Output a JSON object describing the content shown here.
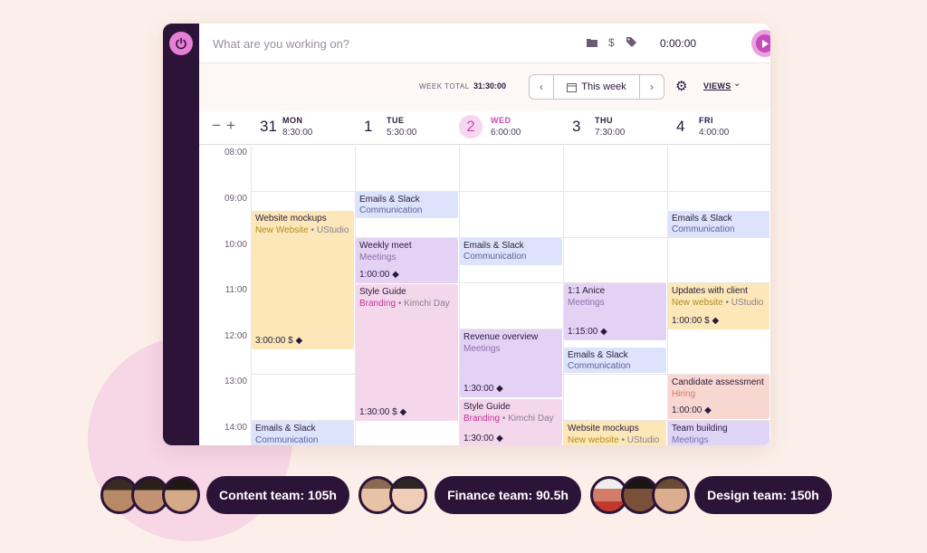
{
  "topbar": {
    "placeholder": "What are you working on?",
    "timer": "0:00:00",
    "icons": [
      "folder-icon",
      "dollar-icon",
      "tag-icon",
      "play-icon",
      "clock-icon",
      "list-icon"
    ]
  },
  "subbar": {
    "week_total_label": "WEEK TOTAL",
    "week_total_value": "31:30:00",
    "week_label": "This week",
    "views_label": "VIEWS"
  },
  "days": [
    {
      "num": "31",
      "name": "MON",
      "total": "8:30:00",
      "today": false
    },
    {
      "num": "1",
      "name": "TUE",
      "total": "5:30:00",
      "today": false
    },
    {
      "num": "2",
      "name": "WED",
      "total": "6:00:00",
      "today": true
    },
    {
      "num": "3",
      "name": "THU",
      "total": "7:30:00",
      "today": false
    },
    {
      "num": "4",
      "name": "FRI",
      "total": "4:00:00",
      "today": false
    }
  ],
  "hours": [
    "08:00",
    "09:00",
    "10:00",
    "11:00",
    "12:00",
    "13:00",
    "14:00"
  ],
  "events": {
    "mon_website": {
      "title": "Website mockups",
      "project": "New Website",
      "client": "UStudio",
      "duration": "3:00:00"
    },
    "mon_emails": {
      "title": "Emails & Slack",
      "project": "Communication"
    },
    "tue_emails": {
      "title": "Emails & Slack",
      "project": "Communication"
    },
    "tue_weekly": {
      "title": "Weekly meet",
      "project": "Meetings",
      "duration": "1:00:00"
    },
    "tue_style": {
      "title": "Style Guide",
      "project": "Branding",
      "client": "Kimchi Day",
      "duration": "1:30:00"
    },
    "wed_emails": {
      "title": "Emails & Slack",
      "project": "Communication"
    },
    "wed_revenue": {
      "title": "Revenue overview",
      "project": "Meetings",
      "duration": "1:30:00"
    },
    "wed_style": {
      "title": "Style Guide",
      "project": "Branding",
      "client": "Kimchi Day",
      "duration": "1:30:00"
    },
    "thu_anice": {
      "title": "1:1 Anice",
      "project": "Meetings",
      "duration": "1:15:00"
    },
    "thu_emails": {
      "title": "Emails & Slack",
      "project": "Communication"
    },
    "thu_website": {
      "title": "Website mockups",
      "project": "New website",
      "client": "UStudio"
    },
    "fri_emails": {
      "title": "Emails & Slack",
      "project": "Communication"
    },
    "fri_updates": {
      "title": "Updates with client",
      "project": "New website",
      "client": "UStudio",
      "duration": "1:00:00"
    },
    "fri_candidate": {
      "title": "Candidate assessment",
      "project": "Hiring",
      "duration": "1:00:00"
    },
    "fri_team": {
      "title": "Team building",
      "project": "Meetings"
    }
  },
  "teams": [
    {
      "label": "Content team: 105h"
    },
    {
      "label": "Finance team: 90.5h"
    },
    {
      "label": "Design team: 150h"
    }
  ],
  "colors": {
    "sidebar": "#2c1338",
    "accent": "#c64bbd",
    "background": "#fcefe9"
  }
}
